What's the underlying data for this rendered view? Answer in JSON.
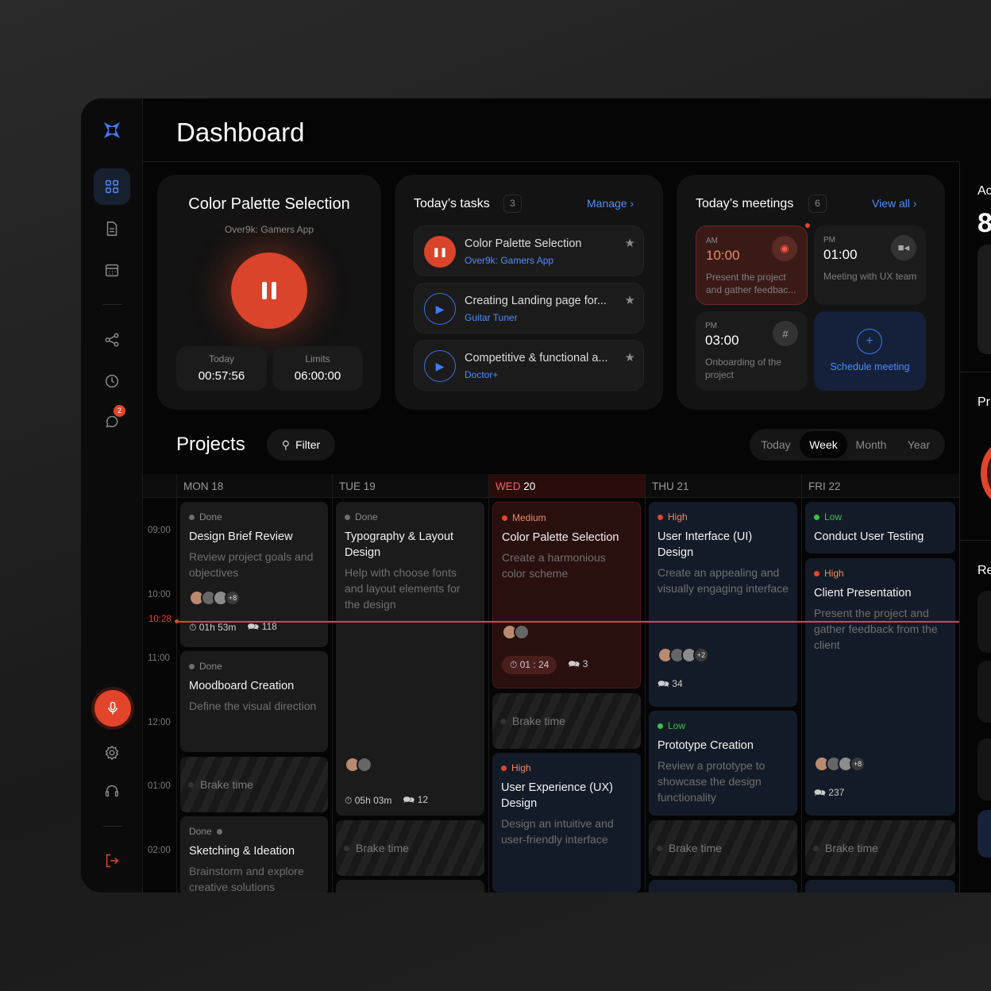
{
  "header": {
    "title": "Dashboard"
  },
  "sidebar": {
    "items": [
      "dashboard",
      "documents",
      "calendar",
      "share",
      "history",
      "messages"
    ],
    "badge": "2",
    "bottom": [
      "microphone",
      "settings",
      "support",
      "logout"
    ]
  },
  "timer": {
    "title": "Color Palette Selection",
    "subtitle": "Over9k: Gamers App",
    "today_label": "Today",
    "today_value": "00:57:56",
    "limits_label": "Limits",
    "limits_value": "06:00:00"
  },
  "tasks": {
    "title": "Today’s tasks",
    "count": "3",
    "manage": "Manage",
    "items": [
      {
        "title": "Color Palette Selection",
        "project": "Over9k: Gamers App",
        "state": "playing"
      },
      {
        "title": "Creating Landing page for...",
        "project": "Guitar Tuner",
        "state": "paused"
      },
      {
        "title": "Competitive & functional a...",
        "project": "Doctor+",
        "state": "paused"
      }
    ]
  },
  "meetings": {
    "title": "Today’s meetings",
    "count": "6",
    "view_all": "View all",
    "items": [
      {
        "ampm": "AM",
        "time": "10:00",
        "desc": "Present the project and gather feedbac...",
        "app": "discord-icon"
      },
      {
        "ampm": "PM",
        "time": "01:00",
        "desc": "Meeting with UX team",
        "app": "video-icon"
      },
      {
        "ampm": "PM",
        "time": "03:00",
        "desc": "Onboarding of the project",
        "app": "slack-icon"
      }
    ],
    "schedule": "Schedule meeting"
  },
  "projects": {
    "title": "Projects",
    "filter": "Filter",
    "ranges": [
      "Today",
      "Week",
      "Month",
      "Year"
    ],
    "active_range": "Week"
  },
  "calendar": {
    "days": [
      {
        "dow": "MON",
        "num": "18"
      },
      {
        "dow": "TUE",
        "num": "19"
      },
      {
        "dow": "WED",
        "num": "20"
      },
      {
        "dow": "THU",
        "num": "21"
      },
      {
        "dow": "FRI",
        "num": "22"
      }
    ],
    "hours": [
      "09:00",
      "10:00",
      "11:00",
      "12:00",
      "01:00",
      "02:00"
    ],
    "now": "10:28",
    "brake_label": "Brake time",
    "events": [
      {
        "day": 0,
        "status": "Done",
        "title": "Design Brief Review",
        "desc": "Review project goals and objectives",
        "avatars_extra": "+8",
        "time": "01h 53m",
        "comments": "118"
      },
      {
        "day": 0,
        "status": "Done",
        "title": "Moodboard Creation",
        "desc": "Define the visual direction"
      },
      {
        "day": 0,
        "status": "Done",
        "title": "Sketching & Ideation",
        "desc": "Brainstorm and explore creative solutions"
      },
      {
        "day": 1,
        "status": "Done",
        "title": "Typography & Layout Design",
        "desc": "Help with choose fonts and layout elements for the design",
        "time": "05h 03m",
        "comments": "12"
      },
      {
        "day": 2,
        "status": "Medium",
        "title": "Color Palette Selection",
        "desc": "Create a harmonious color scheme",
        "time": "01 : 24",
        "comments": "3"
      },
      {
        "day": 2,
        "status": "High",
        "title": "User Experience (UX) Design",
        "desc": "Design an intuitive and user-friendly interface"
      },
      {
        "day": 3,
        "status": "High",
        "title": "User Interface (UI) Design",
        "desc": "Create an appealing and visually engaging interface",
        "avatars_extra": "+2",
        "comments": "34"
      },
      {
        "day": 3,
        "status": "Low",
        "title": "Prototype Creation",
        "desc": "Review a prototype to showcase the design functionality"
      },
      {
        "day": 4,
        "status": "Low",
        "title": "Conduct User Testing",
        "desc": ""
      },
      {
        "day": 4,
        "status": "High",
        "title": "Client Presentation",
        "desc": "Present the project and gather feedback from the client",
        "avatars_extra": "+8",
        "comments": "237"
      }
    ]
  },
  "right_panel": {
    "section1": "Ac",
    "big": "8",
    "section2": "Pr",
    "section3": "Re"
  },
  "colors": {
    "accent": "#3b7bff",
    "danger": "#e2452b",
    "done": "#6e6e6e",
    "low": "#35c24a",
    "bg": "#050505"
  }
}
